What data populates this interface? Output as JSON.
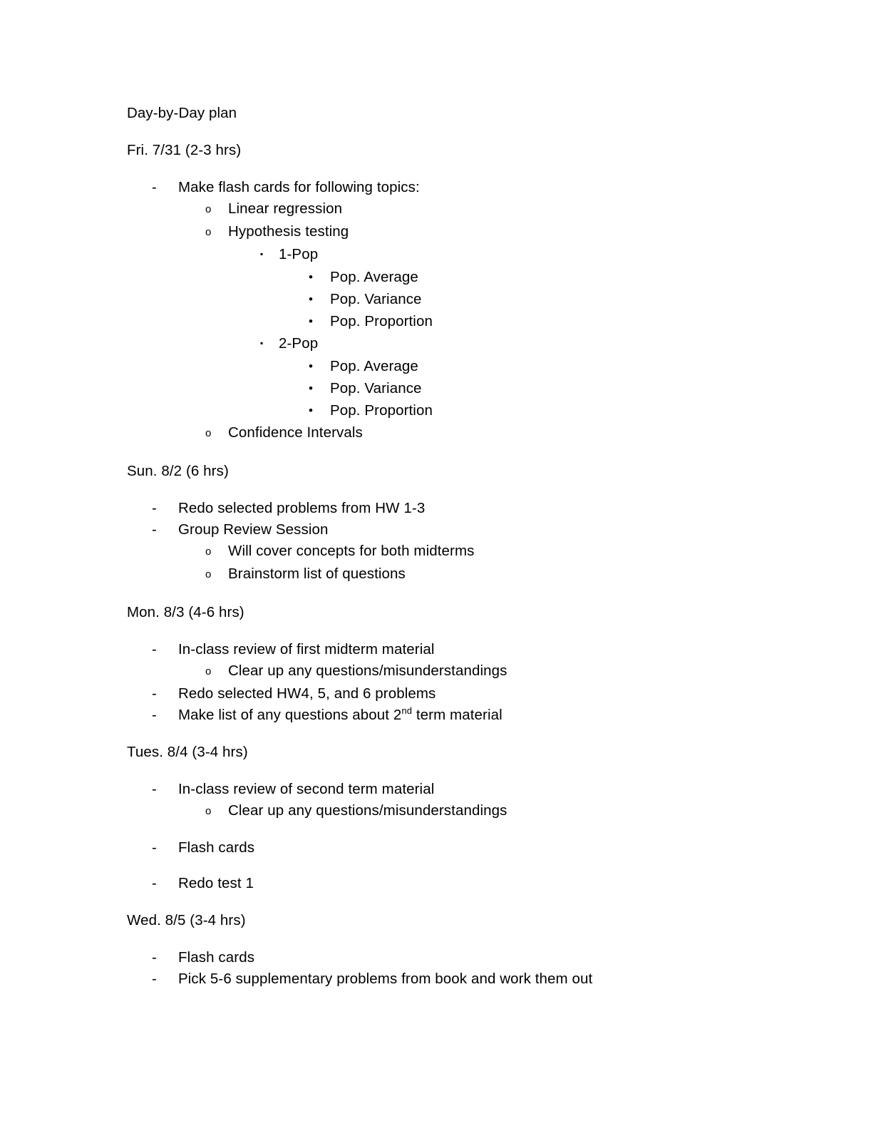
{
  "document": {
    "title": "Day-by-Day plan",
    "markers": {
      "level1": "-",
      "level2": "o",
      "level3": "▪",
      "level4": "•"
    },
    "sections": [
      {
        "heading": "Fri. 7/31 (2-3 hrs)",
        "items": [
          {
            "level": 1,
            "text": "Make flash cards for following topics:"
          },
          {
            "level": 2,
            "text": "Linear regression"
          },
          {
            "level": 2,
            "text": "Hypothesis testing"
          },
          {
            "level": 3,
            "text": "1-Pop"
          },
          {
            "level": 4,
            "text": "Pop. Average"
          },
          {
            "level": 4,
            "text": "Pop. Variance"
          },
          {
            "level": 4,
            "text": "Pop. Proportion"
          },
          {
            "level": 3,
            "text": "2-Pop"
          },
          {
            "level": 4,
            "text": "Pop. Average"
          },
          {
            "level": 4,
            "text": "Pop. Variance"
          },
          {
            "level": 4,
            "text": "Pop. Proportion"
          },
          {
            "level": 2,
            "text": "Confidence Intervals"
          }
        ]
      },
      {
        "heading": "Sun. 8/2 (6 hrs)",
        "items": [
          {
            "level": 1,
            "text": "Redo selected problems from HW 1-3"
          },
          {
            "level": 1,
            "text": "Group Review Session"
          },
          {
            "level": 2,
            "text": "Will cover concepts for both midterms"
          },
          {
            "level": 2,
            "text": "Brainstorm list of questions"
          }
        ]
      },
      {
        "heading": "Mon. 8/3 (4-6 hrs)",
        "items": [
          {
            "level": 1,
            "text": "In-class review of first midterm material"
          },
          {
            "level": 2,
            "text": "Clear up any questions/misunderstandings"
          },
          {
            "level": 1,
            "text": "Redo selected HW4, 5, and 6 problems"
          },
          {
            "level": 1,
            "text_pre": "Make list of any questions about 2",
            "superscript": "nd",
            "text_post": " term material"
          }
        ]
      },
      {
        "heading": "Tues. 8/4 (3-4 hrs)",
        "items": [
          {
            "level": 1,
            "text": "In-class review of second term material"
          },
          {
            "level": 2,
            "text": "Clear up any questions/misunderstandings"
          },
          {
            "level": 1,
            "text": "Flash cards",
            "gap_before": true
          },
          {
            "level": 1,
            "text": "Redo test 1",
            "gap_before": true
          }
        ]
      },
      {
        "heading": "Wed. 8/5 (3-4 hrs)",
        "items": [
          {
            "level": 1,
            "text": "Flash cards"
          },
          {
            "level": 1,
            "text": "Pick 5-6 supplementary problems from book and work them out"
          }
        ]
      }
    ]
  }
}
